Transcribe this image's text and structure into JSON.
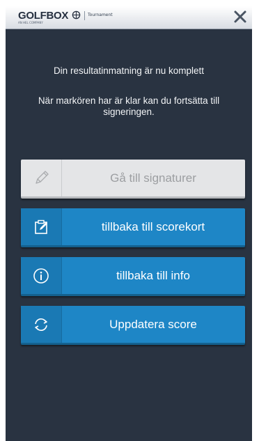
{
  "header": {
    "brand": "GOLFBOX",
    "brand_sub": "AN HEL COMPANY",
    "product": "Tournament",
    "close_icon": "close-icon"
  },
  "messages": {
    "line1": "Din resultatinmatning är nu komplett",
    "line2": "När markören har är klar kan du fortsätta till signeringen."
  },
  "buttons": [
    {
      "label": "Gå till signaturer",
      "icon": "pencil-icon",
      "state": "disabled"
    },
    {
      "label": "tillbaka till scorekort",
      "icon": "clipboard-edit-icon",
      "state": "enabled"
    },
    {
      "label": "tillbaka till info",
      "icon": "info-icon",
      "state": "enabled"
    },
    {
      "label": "Uppdatera score",
      "icon": "refresh-icon",
      "state": "enabled"
    }
  ],
  "colors": {
    "background": "#293341",
    "button_blue": "#1e86c6",
    "button_disabled": "#e4e5e7"
  }
}
